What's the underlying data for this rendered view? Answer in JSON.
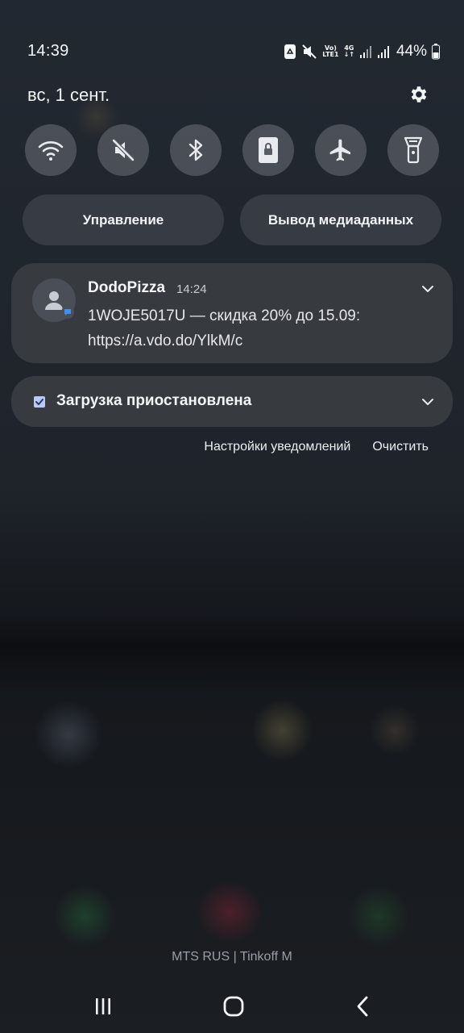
{
  "status_bar": {
    "time": "14:39",
    "volte_label_top": "Vo)",
    "volte_label_bottom": "LTE1",
    "network_label": "4G",
    "battery": "44%"
  },
  "header": {
    "date": "вс, 1 сент."
  },
  "quick_tiles": [
    {
      "icon": "wifi-icon"
    },
    {
      "icon": "sound-muted-icon"
    },
    {
      "icon": "bluetooth-icon"
    },
    {
      "icon": "portrait-lock-icon"
    },
    {
      "icon": "airplane-icon"
    },
    {
      "icon": "flashlight-icon"
    }
  ],
  "buttons": {
    "device_control": "Управление",
    "media_output": "Вывод медиаданных"
  },
  "notification": {
    "app_name": "DodoPizza",
    "time": "14:24",
    "text": "1WOJE5017U — скидка 20% до 15.09: https://a.vdo.do/YlkM/c"
  },
  "download": {
    "title": "Загрузка приостановлена"
  },
  "actions": {
    "settings": "Настройки уведомлений",
    "clear": "Очистить"
  },
  "carrier_text": "MTS RUS | Tinkoff M",
  "colors": {
    "panel": "#383c42",
    "tile": "#585d66",
    "accent_blue": "#3d8ff5"
  }
}
